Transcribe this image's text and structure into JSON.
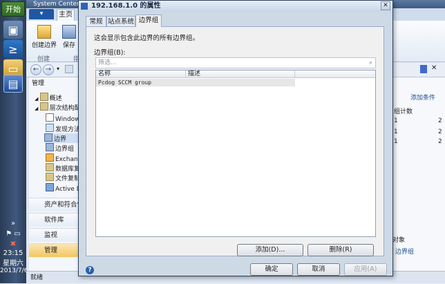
{
  "taskbar": {
    "start_label": "开始",
    "clock_time": "23:15",
    "clock_day": "星期六",
    "clock_date": "2013/7/6"
  },
  "console": {
    "title": "System Center",
    "file_tab": "",
    "home_tab": "主页",
    "ribbon_buttons": [
      "创建边界",
      "保存"
    ],
    "ribbon_groups": [
      "创建",
      "指"
    ],
    "nav_tree": [
      {
        "label": "概述",
        "icon": "overview-icon"
      },
      {
        "label": "层次结构配",
        "icon": "folder-icon"
      },
      {
        "label": "Window",
        "icon": "windows-icon"
      },
      {
        "label": "发现方法",
        "icon": "discovery-icon"
      },
      {
        "label": "边界",
        "icon": "boundary-icon"
      },
      {
        "label": "边界组",
        "icon": "boundary-group-icon"
      },
      {
        "label": "Exchang",
        "icon": "exchange-icon"
      },
      {
        "label": "数据库复",
        "icon": "database-icon"
      },
      {
        "label": "文件复制",
        "icon": "file-copy-icon"
      },
      {
        "label": "Active D",
        "icon": "active-directory-icon"
      }
    ],
    "nav_section_title": "管理",
    "workspaces": [
      "资产和符合性",
      "软件库",
      "监视",
      "管理"
    ],
    "status": "就绪",
    "right_panel": {
      "add_condition": "添加条件",
      "col_header": "组计数",
      "rows": [
        "1",
        "1",
        "1"
      ],
      "col2_values": [
        "2",
        "2",
        "2"
      ],
      "object_label": "对象",
      "link": "边界组"
    }
  },
  "dialog": {
    "title": "192.168.1.0 的属性",
    "tabs": [
      "常规",
      "站点系统",
      "边界组"
    ],
    "active_tab_index": 2,
    "description": "这会显示包含此边界的所有边界组。",
    "list_label": "边界组(B):",
    "filter_placeholder": "筛选...",
    "columns": [
      "名称",
      "描述"
    ],
    "rows": [
      {
        "name": "Pcdog SCCM group",
        "desc": ""
      }
    ],
    "add_button": "添加(D)...",
    "remove_button": "删除(R)",
    "ok_button": "确定",
    "cancel_button": "取消",
    "apply_button": "应用(A)"
  }
}
